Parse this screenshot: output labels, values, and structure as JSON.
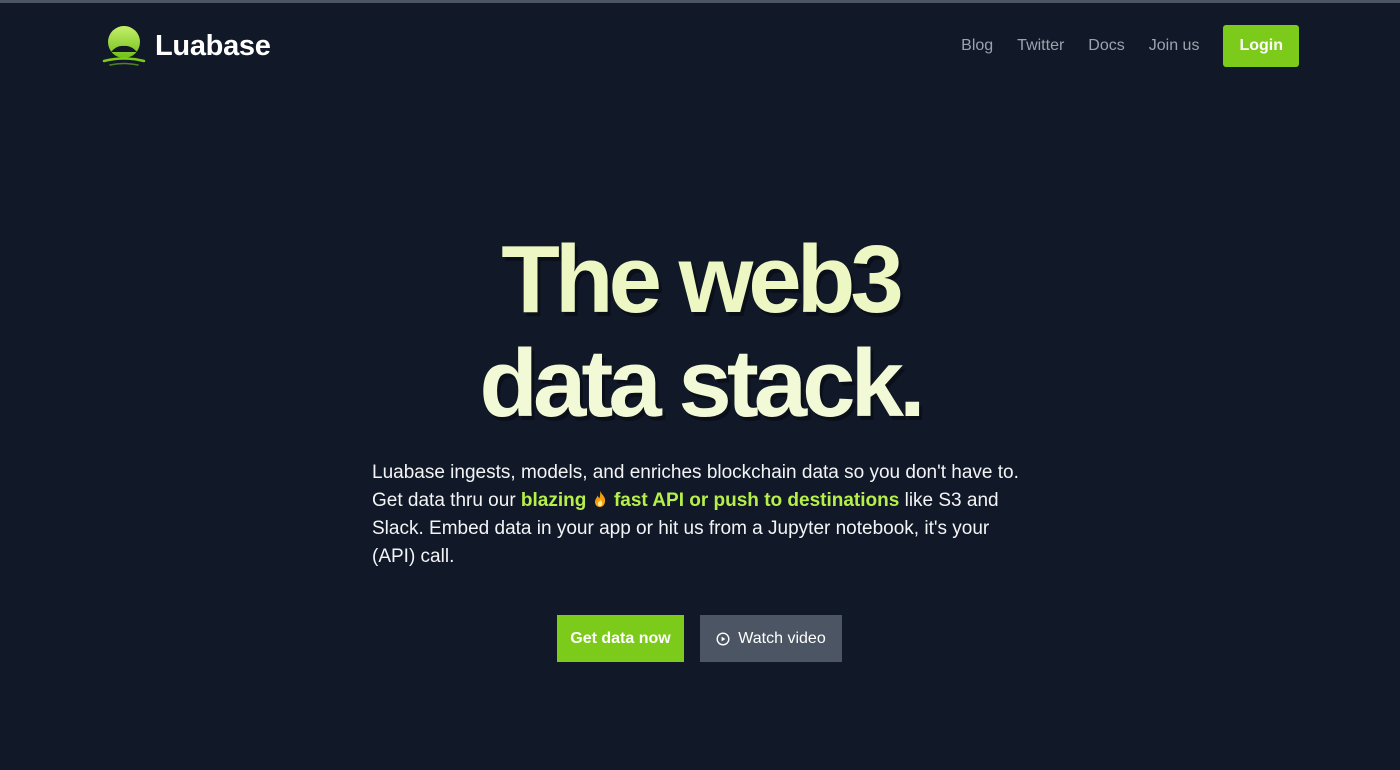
{
  "brand": {
    "name": "Luabase",
    "logo_icon": "luabase-logo-icon"
  },
  "nav": {
    "links": [
      "Blog",
      "Twitter",
      "Docs",
      "Join us"
    ],
    "login_label": "Login"
  },
  "hero": {
    "title_line1": "The web3",
    "title_line2": "data stack.",
    "desc_part1": "Luabase ingests, models, and enriches blockchain data so you don't have to. Get data thru our ",
    "highlight_1": "blazing",
    "highlight_2": "fast API or push to destinations",
    "desc_part2": " like S3 and Slack. Embed data in your app or hit us from a Jupyter notebook, it's your (API) call.",
    "fire_icon": "fire-icon"
  },
  "cta": {
    "primary_label": "Get data now",
    "secondary_label": "Watch video",
    "secondary_icon": "play-circle-icon"
  },
  "colors": {
    "background": "#111827",
    "accent": "#7ccb1a",
    "highlight": "#b5f04a",
    "title": "#eef8cc",
    "nav_link": "#9ca3af",
    "secondary_button": "#4b5563"
  }
}
